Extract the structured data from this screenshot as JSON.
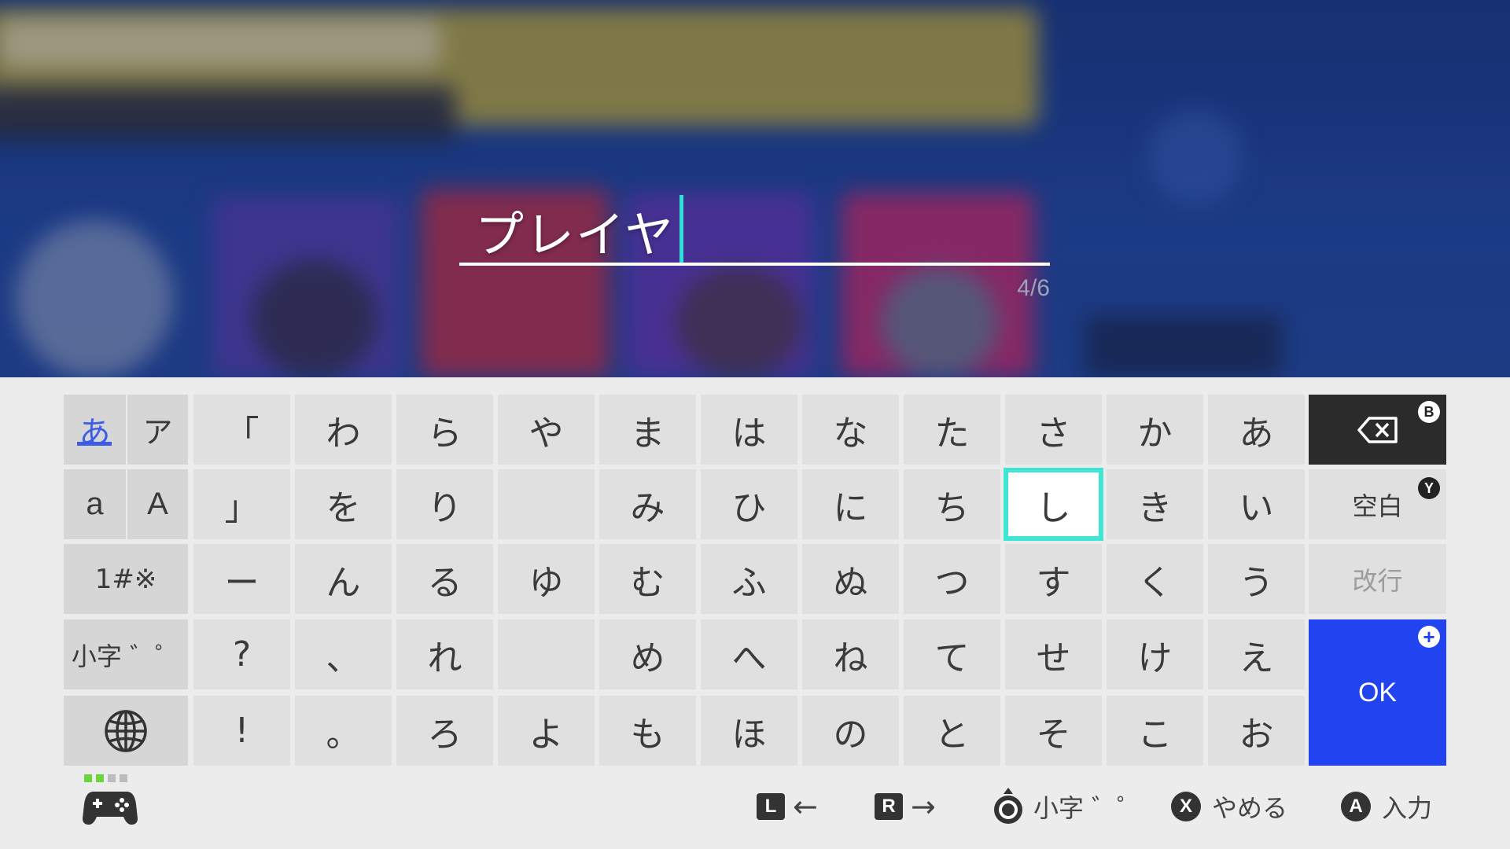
{
  "text_field": {
    "value": "プレイヤ",
    "count": "4/6"
  },
  "mode_keys": {
    "hiragana": "あ",
    "katakana": "ア",
    "lower_latin": "a",
    "upper_latin": "A",
    "symbols": "1#※",
    "small_kana": "小字 ゛゜",
    "globe_icon": "globe-icon"
  },
  "kana_grid": [
    [
      "「",
      "わ",
      "ら",
      "や",
      "ま",
      "は",
      "な",
      "た",
      "さ",
      "か",
      "あ"
    ],
    [
      "」",
      "を",
      "り",
      "",
      "み",
      "ひ",
      "に",
      "ち",
      "し",
      "き",
      "い"
    ],
    [
      "ー",
      "ん",
      "る",
      "ゆ",
      "む",
      "ふ",
      "ぬ",
      "つ",
      "す",
      "く",
      "う"
    ],
    [
      "?",
      "、",
      "れ",
      "",
      "め",
      "へ",
      "ね",
      "て",
      "せ",
      "け",
      "え"
    ],
    [
      "!",
      "。",
      "ろ",
      "よ",
      "も",
      "ほ",
      "の",
      "と",
      "そ",
      "こ",
      "お"
    ]
  ],
  "selected_key": "し",
  "action_keys": {
    "backspace_icon": "backspace-icon",
    "backspace_badge": "B",
    "space": "空白",
    "space_badge": "Y",
    "newline": "改行",
    "ok": "OK",
    "ok_badge": "+"
  },
  "footer": {
    "l_button": "L",
    "r_button": "R",
    "stick_label": "小字 ゛゜",
    "x_button": "X",
    "cancel": "やめる",
    "a_button": "A",
    "enter": "入力"
  },
  "colors": {
    "selection": "#3fe6d4",
    "ok_key": "#2244f0",
    "active_mode": "#3c5ce8",
    "caret": "#2fe0d6"
  }
}
